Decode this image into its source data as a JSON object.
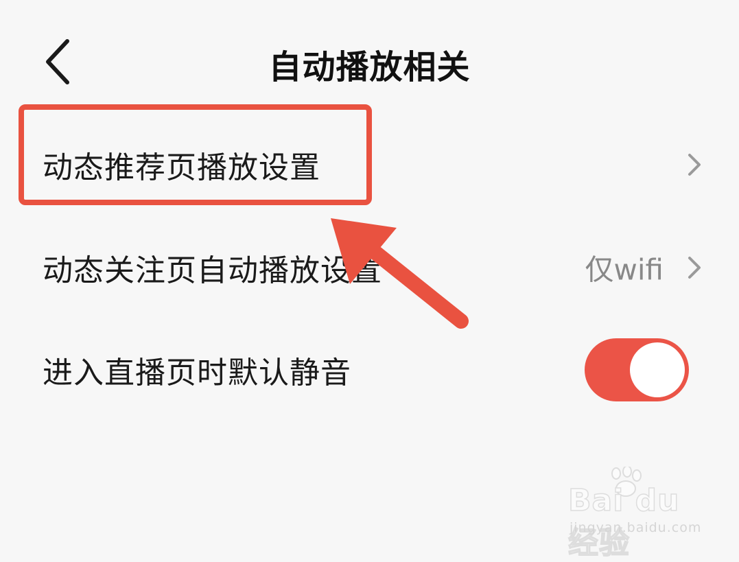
{
  "header": {
    "title": "自动播放相关"
  },
  "rows": [
    {
      "label": "动态推荐页播放设置",
      "value": ""
    },
    {
      "label": "动态关注页自动播放设置",
      "value": "仅wifi"
    },
    {
      "label": "进入直播页时默认静音",
      "toggle_on": true
    }
  ],
  "colors": {
    "accent": "#eb5447",
    "annotation": "#e95240",
    "value_text": "#888888",
    "background": "#f7f7f7"
  },
  "icons": {
    "back": "chevron-left-icon",
    "row_chevron": "chevron-right-icon",
    "arrow": "annotation-arrow"
  },
  "watermark": {
    "brand": "Bai du 经验",
    "url": "jingyan.baidu.com"
  }
}
